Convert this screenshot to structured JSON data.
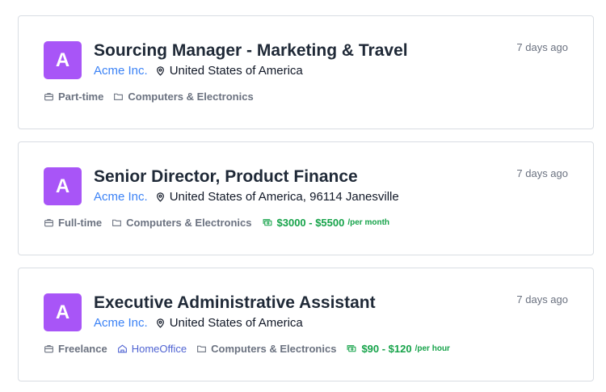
{
  "jobs": [
    {
      "avatar_letter": "A",
      "title": "Sourcing Manager - Marketing & Travel",
      "company": "Acme Inc.",
      "location": "United States of America",
      "posted": "7 days ago",
      "employment_type": "Part-time",
      "remote": "",
      "category": "Computers & Electronics",
      "salary_range": "",
      "salary_period": ""
    },
    {
      "avatar_letter": "A",
      "title": "Senior Director, Product Finance",
      "company": "Acme Inc.",
      "location": "United States of America, 96114 Janesville",
      "posted": "7 days ago",
      "employment_type": "Full-time",
      "remote": "",
      "category": "Computers & Electronics",
      "salary_range": "$3000 - $5500",
      "salary_period": "/per month"
    },
    {
      "avatar_letter": "A",
      "title": "Executive Administrative Assistant",
      "company": "Acme Inc.",
      "location": "United States of America",
      "posted": "7 days ago",
      "employment_type": "Freelance",
      "remote": "HomeOffice",
      "category": "Computers & Electronics",
      "salary_range": "$90 - $120",
      "salary_period": "/per hour"
    }
  ],
  "colors": {
    "avatar": "#a855f7",
    "company_link": "#3b82f6",
    "salary": "#16a34a",
    "remote": "#4f63d2",
    "muted": "#6b7280"
  },
  "icons": {
    "location": "map-pin-icon",
    "employment_type": "briefcase-icon",
    "category": "folder-icon",
    "remote": "home-icon",
    "salary": "money-bills-icon"
  }
}
